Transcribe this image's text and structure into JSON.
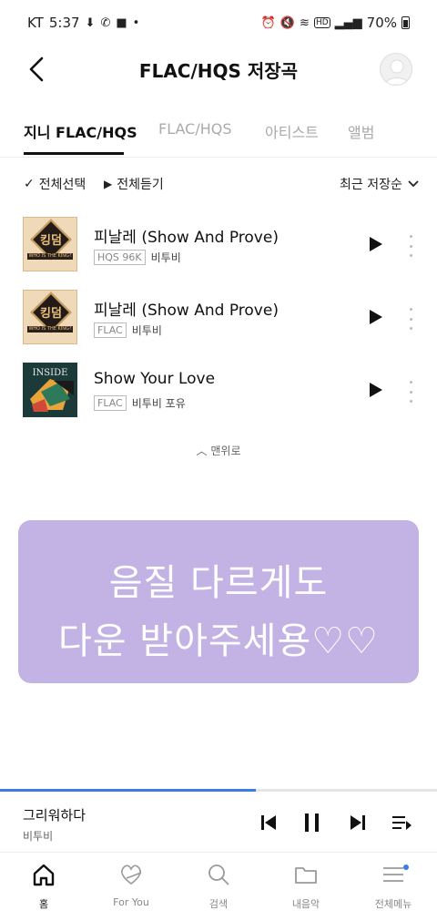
{
  "status_bar": {
    "carrier": "KT",
    "time": "5:37",
    "battery": "70%"
  },
  "header": {
    "title": "FLAC/HQS 저장곡"
  },
  "tabs": [
    {
      "label": "지니 FLAC/HQS",
      "active": true
    },
    {
      "label": "FLAC/HQS",
      "active": false
    },
    {
      "label": "아티스트",
      "active": false
    },
    {
      "label": "앨범",
      "active": false
    }
  ],
  "toolbar": {
    "select_all": "전체선택",
    "play_all": "전체듣기",
    "sort": "최근 저장순"
  },
  "tracks": [
    {
      "title": "피날레 (Show And Prove)",
      "quality": "HQS 96K",
      "artist": "비투비",
      "cover_text": "킹덤",
      "cover_band": "WHO IS THE KING?"
    },
    {
      "title": "피날레 (Show And Prove)",
      "quality": "FLAC",
      "artist": "비투비",
      "cover_text": "킹덤",
      "cover_band": "WHO IS THE KING?"
    },
    {
      "title": "Show Your Love",
      "quality": "FLAC",
      "artist": "비투비 포유",
      "cover_text": "INSIDE"
    }
  ],
  "to_top": "맨위로",
  "overlay": {
    "line1": "음질 다르게도",
    "line2": "다운 받아주세용♡♡"
  },
  "now_playing": {
    "title": "그리워하다",
    "artist": "비투비",
    "progress": 0.585
  },
  "bottom_nav": [
    {
      "label": "홈",
      "icon": "home-icon",
      "active": true
    },
    {
      "label": "For You",
      "icon": "heart-arrow-icon",
      "active": false
    },
    {
      "label": "검색",
      "icon": "search-icon",
      "active": false
    },
    {
      "label": "내음악",
      "icon": "folder-icon",
      "active": false
    },
    {
      "label": "전체메뉴",
      "icon": "menu-icon",
      "active": false
    }
  ],
  "colors": {
    "accent": "#3b7be8",
    "overlay": "#c3b2e4"
  }
}
